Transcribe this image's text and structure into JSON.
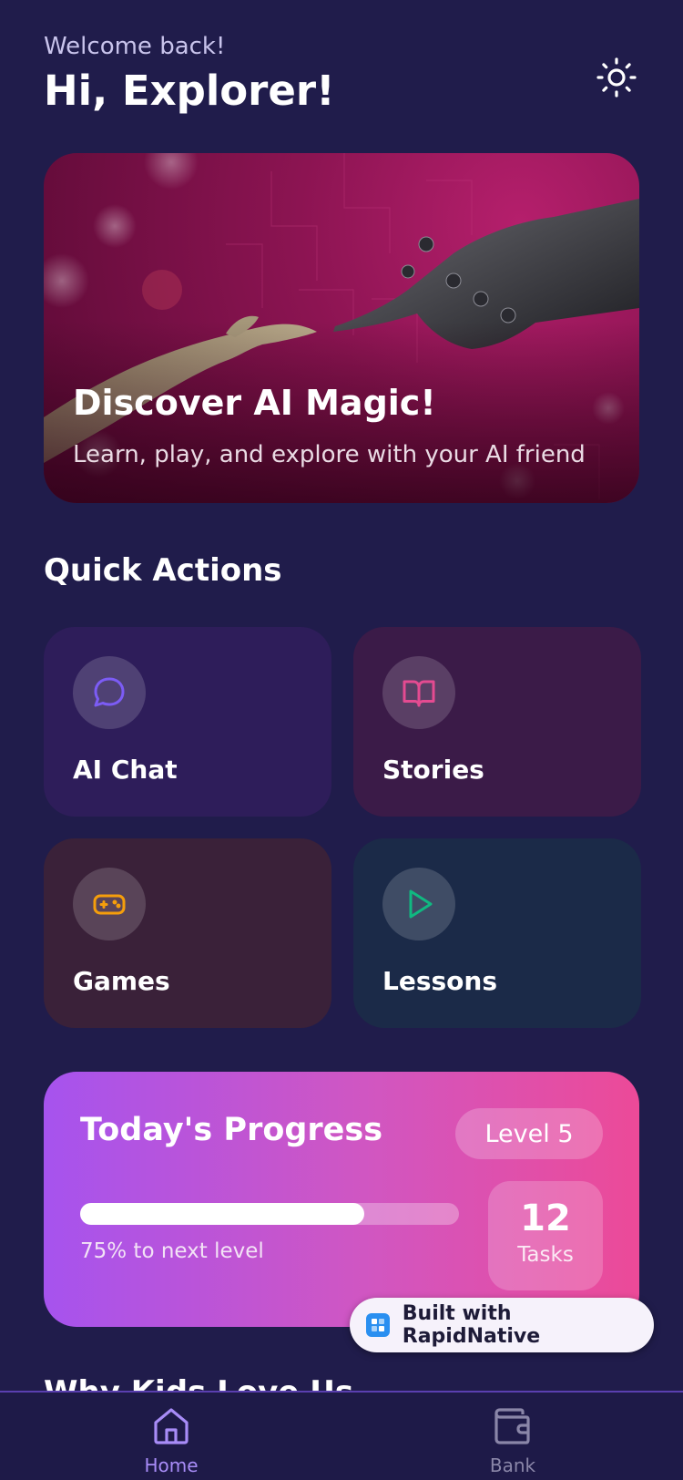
{
  "header": {
    "welcome": "Welcome back!",
    "greeting": "Hi, Explorer!",
    "theme_icon": "sun-icon"
  },
  "hero": {
    "title": "Discover AI Magic!",
    "subtitle": "Learn, play, and explore with your AI friend",
    "image": "human-hand-touching-robot-hand"
  },
  "quick_actions": {
    "title": "Quick Actions",
    "items": [
      {
        "label": "AI Chat",
        "icon": "chat-bubble-icon",
        "color": "#7c5cf5"
      },
      {
        "label": "Stories",
        "icon": "book-open-icon",
        "color": "#e44b91"
      },
      {
        "label": "Games",
        "icon": "gamepad-icon",
        "color": "#f59e0b"
      },
      {
        "label": "Lessons",
        "icon": "play-icon",
        "color": "#10b981"
      }
    ]
  },
  "progress": {
    "title": "Today's Progress",
    "level": "Level 5",
    "percent": 75,
    "caption": "75% to next level",
    "tasks_count": "12",
    "tasks_label": "Tasks"
  },
  "next_section": {
    "title_partial": "Why Kids Love Us"
  },
  "badge": {
    "text": "Built with RapidNative"
  },
  "tabbar": {
    "items": [
      {
        "label": "Home",
        "icon": "home-icon",
        "active": true
      },
      {
        "label": "Bank",
        "icon": "wallet-icon",
        "active": false
      }
    ]
  },
  "colors": {
    "background": "#201c4b",
    "accent": "#a88cf7",
    "progress_start": "#a653ee",
    "progress_end": "#ec4a98"
  }
}
